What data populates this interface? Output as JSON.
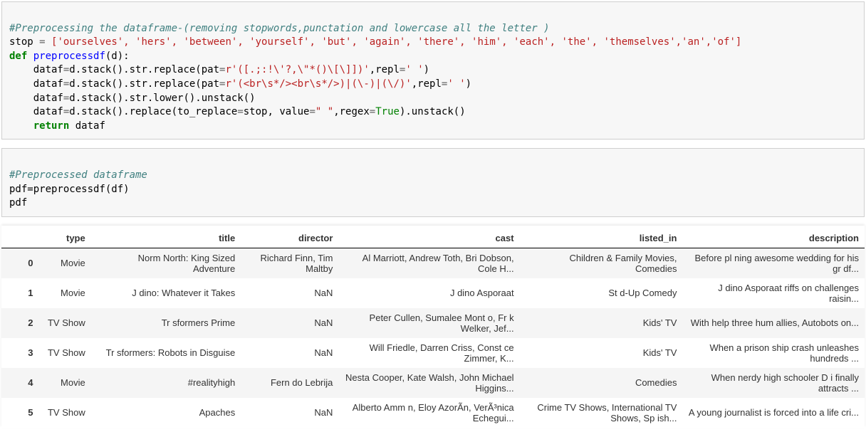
{
  "cell1": {
    "comment": "#Preprocessing the dataframe-(removing stopwords,punctation and lowercase all the letter )",
    "stop_assign_pre": "stop ",
    "stop_list": "['ourselves', 'hers', 'between', 'yourself', 'but', 'again', 'there', 'him', 'each', 'the', 'themselves','an','of']",
    "def_kw": "def",
    "func_name": " preprocessdf",
    "func_args": "(d):",
    "l1_a": "    dataf",
    "l1_b": "d.stack().str.replace(pat",
    "l1_pat": "r'([.;:!\\'?,\\\"*()\\[\\]])'",
    "l1_c": ",repl",
    "l1_repl": "' '",
    "l1_d": ")",
    "l2_a": "    dataf",
    "l2_b": "d.stack().str.replace(pat",
    "l2_pat": "r'(<br\\s*/><br\\s*/>)|(\\-)|(\\/)'",
    "l2_c": ",repl",
    "l2_repl": "' '",
    "l2_d": ")",
    "l3_a": "    dataf",
    "l3_b": "d.stack().str.lower().unstack()",
    "l4_a": "    dataf",
    "l4_b": "d.stack().replace(to_replace",
    "l4_c": "stop, value",
    "l4_val": "\" \"",
    "l4_d": ",regex",
    "l4_true": "True",
    "l4_e": ").unstack()",
    "ret_kw": "return",
    "ret_val": " dataf"
  },
  "cell2": {
    "comment": "#Preprocessed dataframe",
    "l1": "pdf=preprocessdf(df)",
    "l2": "pdf"
  },
  "table": {
    "headers": {
      "idx": "",
      "type": "type",
      "title": "title",
      "director": "director",
      "cast": "cast",
      "listed_in": "listed_in",
      "description": "description"
    },
    "rows": [
      {
        "idx": "0",
        "type": "Movie",
        "title": "Norm North: King Sized Adventure",
        "director": "Richard Finn, Tim Maltby",
        "cast": "Al Marriott, Andrew Toth, Bri Dobson, Cole H...",
        "listed_in": "Children & Family Movies, Comedies",
        "description": "Before pl ning awesome wedding for his gr df..."
      },
      {
        "idx": "1",
        "type": "Movie",
        "title": "J dino: Whatever it Takes",
        "director": "NaN",
        "cast": "J dino Asporaat",
        "listed_in": "St d-Up Comedy",
        "description": "J dino Asporaat riffs on challenges raisin..."
      },
      {
        "idx": "2",
        "type": "TV Show",
        "title": "Tr sformers Prime",
        "director": "NaN",
        "cast": "Peter Cullen, Sumalee Mont o, Fr k Welker, Jef...",
        "listed_in": "Kids' TV",
        "description": "With help three hum allies, Autobots on..."
      },
      {
        "idx": "3",
        "type": "TV Show",
        "title": "Tr sformers: Robots in Disguise",
        "director": "NaN",
        "cast": "Will Friedle, Darren Criss, Const ce Zimmer, K...",
        "listed_in": "Kids' TV",
        "description": "When a prison ship crash unleashes hundreds ..."
      },
      {
        "idx": "4",
        "type": "Movie",
        "title": "#realityhigh",
        "director": "Fern do Lebrija",
        "cast": "Nesta Cooper, Kate Walsh, John Michael Higgins...",
        "listed_in": "Comedies",
        "description": "When nerdy high schooler D i finally attracts ..."
      },
      {
        "idx": "5",
        "type": "TV Show",
        "title": "Apaches",
        "director": "NaN",
        "cast": "Alberto Amm n, Eloy AzorÃ­n, VerÃ³nica Echegui...",
        "listed_in": "Crime TV Shows, International TV Shows, Sp ish...",
        "description": "A young journalist is forced into a life cri..."
      }
    ]
  }
}
